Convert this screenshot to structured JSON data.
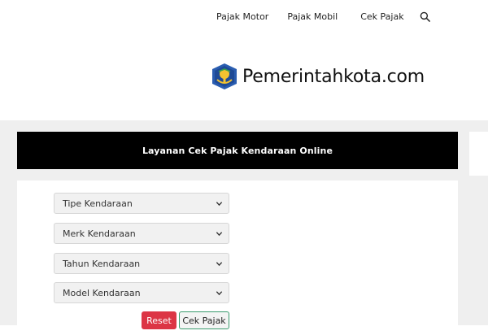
{
  "nav": {
    "items": [
      {
        "label": "Pajak Motor"
      },
      {
        "label": "Pajak Mobil"
      },
      {
        "label": "Cek Pajak"
      }
    ],
    "search_icon": "search-icon"
  },
  "logo": {
    "text": "Pemerintahkota.com",
    "emblem_icon": "government-emblem-icon"
  },
  "title_bar": {
    "text": "Layanan Cek Pajak Kendaraan Online"
  },
  "form": {
    "selects": [
      {
        "selected": "Tipe Kendaraan"
      },
      {
        "selected": "Merk Kendaraan"
      },
      {
        "selected": "Tahun Kendaraan"
      },
      {
        "selected": "Model Kendaraan"
      }
    ],
    "reset_label": "Reset",
    "submit_label": "Cek Pajak"
  },
  "colors": {
    "title_bar_bg": "#000000",
    "reset_bg": "#dc3545",
    "submit_border": "#3a9b6e",
    "page_bg": "#efefef"
  }
}
